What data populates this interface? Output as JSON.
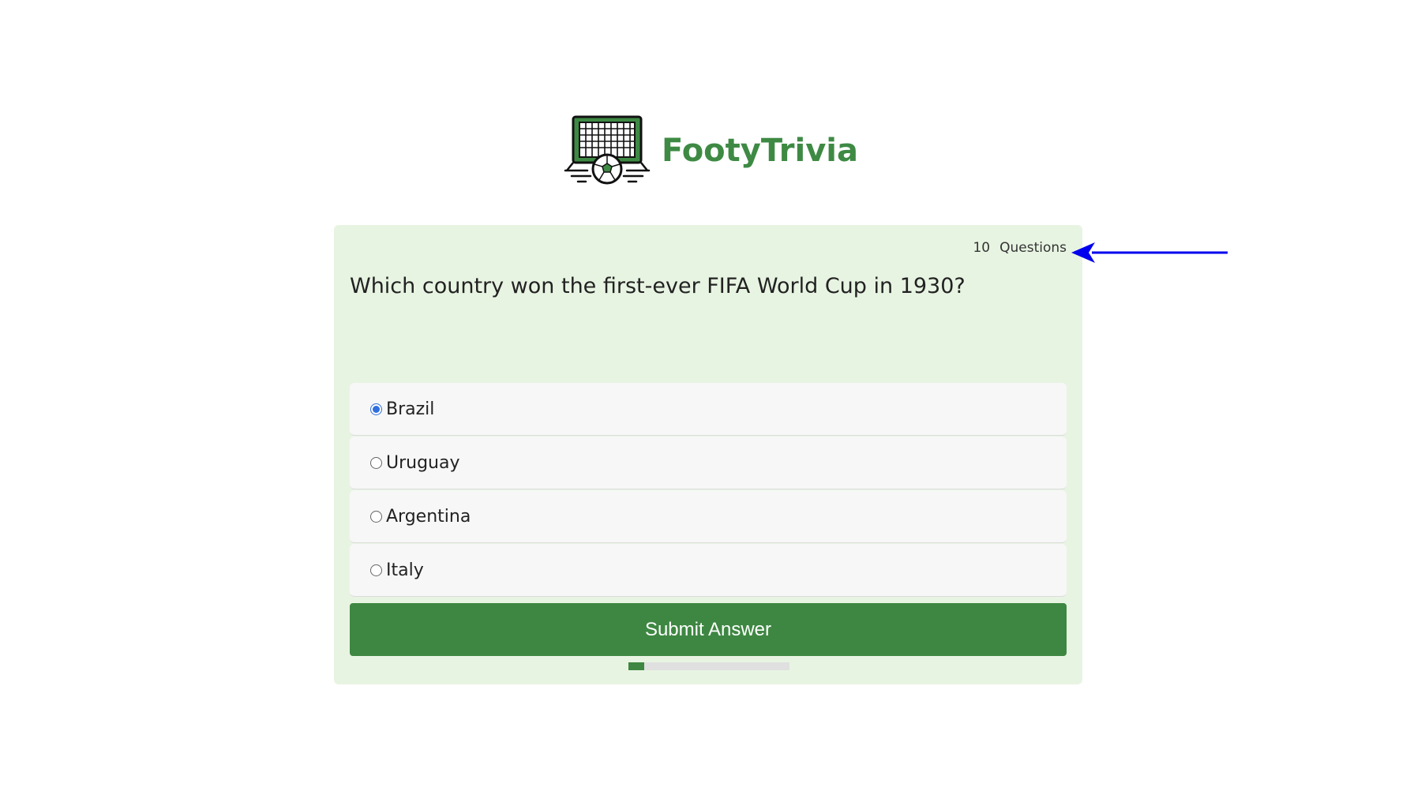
{
  "brand": {
    "name": "FootyTrivia",
    "logo_icon": "soccer-goal-icon",
    "color": "#3e8a44"
  },
  "quiz": {
    "count_number": "10",
    "count_label": "Questions",
    "question": "Which country won the first-ever FIFA World Cup in 1930?",
    "options": [
      {
        "label": "Brazil",
        "selected": true
      },
      {
        "label": "Uruguay",
        "selected": false
      },
      {
        "label": "Argentina",
        "selected": false
      },
      {
        "label": "Italy",
        "selected": false
      }
    ],
    "submit_label": "Submit Answer",
    "progress_fraction": 0.1
  },
  "annotation": {
    "icon": "arrow-left-icon",
    "color": "#0000ee"
  },
  "colors": {
    "card_background": "#e8f4e2",
    "button": "#3e8742",
    "radio_selected": "#2f6fde"
  }
}
